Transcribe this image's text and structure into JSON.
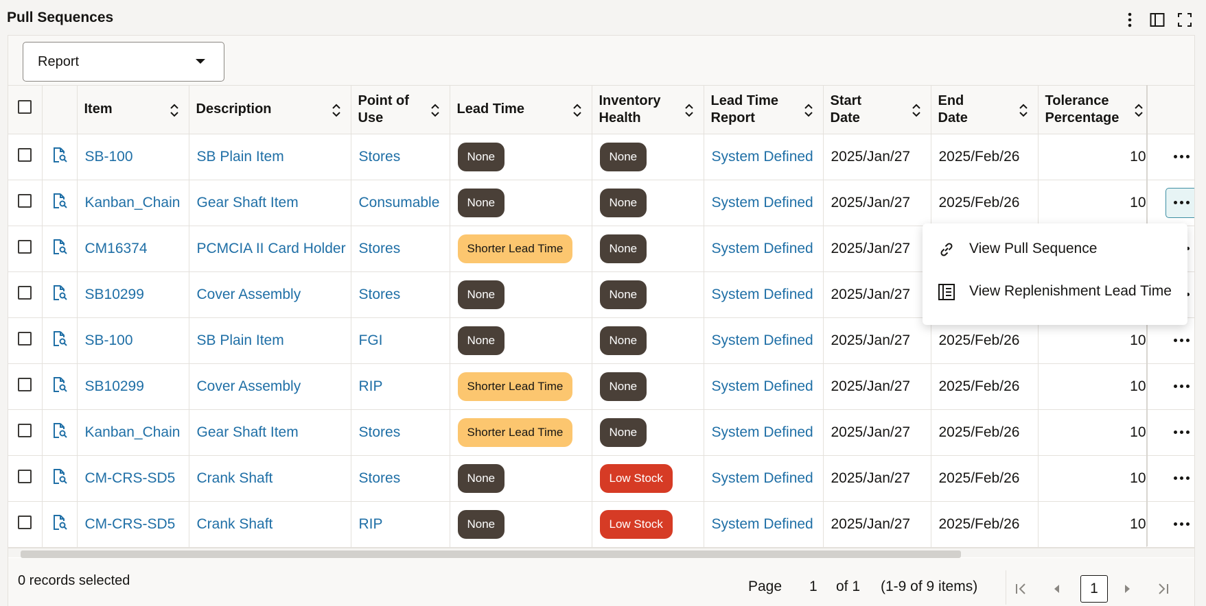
{
  "title": "Pull Sequences",
  "report_select": {
    "value": "Report"
  },
  "columns": {
    "item": "Item",
    "description": "Description",
    "point_of_use": "Point of Use",
    "lead_time": "Lead Time",
    "inventory_health": "Inventory Health",
    "lead_time_report": "Lead Time Report",
    "start_date": "Start Date",
    "end_date": "End Date",
    "tolerance": "Tolerance Percentage"
  },
  "rows": [
    {
      "item": "SB-100",
      "description": "SB Plain Item",
      "point_of_use": "Stores",
      "lead_time": "None",
      "lead_time_type": "none",
      "inventory_health": "None",
      "health_type": "none",
      "lead_time_report": "System Defined",
      "start_date": "2025/Jan/27",
      "end_date": "2025/Feb/26",
      "tolerance": "10"
    },
    {
      "item": "Kanban_Chain",
      "description": "Gear Shaft Item",
      "point_of_use": "Consumable",
      "lead_time": "None",
      "lead_time_type": "none",
      "inventory_health": "None",
      "health_type": "none",
      "lead_time_report": "System Defined",
      "start_date": "2025/Jan/27",
      "end_date": "2025/Feb/26",
      "tolerance": "10"
    },
    {
      "item": "CM16374",
      "description": "PCMCIA II Card Holder",
      "point_of_use": "Stores",
      "lead_time": "Shorter Lead Time",
      "lead_time_type": "short",
      "inventory_health": "None",
      "health_type": "none",
      "lead_time_report": "System Defined",
      "start_date": "2025/Jan/27",
      "end_date": "",
      "tolerance": ""
    },
    {
      "item": "SB10299",
      "description": "Cover Assembly",
      "point_of_use": "Stores",
      "lead_time": "None",
      "lead_time_type": "none",
      "inventory_health": "None",
      "health_type": "none",
      "lead_time_report": "System Defined",
      "start_date": "2025/Jan/27",
      "end_date": "",
      "tolerance": ""
    },
    {
      "item": "SB-100",
      "description": "SB Plain Item",
      "point_of_use": "FGI",
      "lead_time": "None",
      "lead_time_type": "none",
      "inventory_health": "None",
      "health_type": "none",
      "lead_time_report": "System Defined",
      "start_date": "2025/Jan/27",
      "end_date": "2025/Feb/26",
      "tolerance": "10"
    },
    {
      "item": "SB10299",
      "description": "Cover Assembly",
      "point_of_use": "RIP",
      "lead_time": "Shorter Lead Time",
      "lead_time_type": "short",
      "inventory_health": "None",
      "health_type": "none",
      "lead_time_report": "System Defined",
      "start_date": "2025/Jan/27",
      "end_date": "2025/Feb/26",
      "tolerance": "10"
    },
    {
      "item": "Kanban_Chain",
      "description": "Gear Shaft Item",
      "point_of_use": "Stores",
      "lead_time": "Shorter Lead Time",
      "lead_time_type": "short",
      "inventory_health": "None",
      "health_type": "none",
      "lead_time_report": "System Defined",
      "start_date": "2025/Jan/27",
      "end_date": "2025/Feb/26",
      "tolerance": "10"
    },
    {
      "item": "CM-CRS-SD5",
      "description": "Crank Shaft",
      "point_of_use": "Stores",
      "lead_time": "None",
      "lead_time_type": "none",
      "inventory_health": "Low Stock",
      "health_type": "low",
      "lead_time_report": "System Defined",
      "start_date": "2025/Jan/27",
      "end_date": "2025/Feb/26",
      "tolerance": "10"
    },
    {
      "item": "CM-CRS-SD5",
      "description": "Crank Shaft",
      "point_of_use": "RIP",
      "lead_time": "None",
      "lead_time_type": "none",
      "inventory_health": "Low Stock",
      "health_type": "low",
      "lead_time_report": "System Defined",
      "start_date": "2025/Jan/27",
      "end_date": "2025/Feb/26",
      "tolerance": "10"
    }
  ],
  "active_row": 1,
  "menu": {
    "items": [
      {
        "label": "View Pull Sequence",
        "icon": "link-icon"
      },
      {
        "label": "View Replenishment Lead Time",
        "icon": "report-icon"
      }
    ]
  },
  "footer": {
    "selected": "0 records selected",
    "page_label": "Page",
    "page_num": "1",
    "of_label": "of 1",
    "range": "(1-9 of 9 items)",
    "current_page": "1"
  }
}
